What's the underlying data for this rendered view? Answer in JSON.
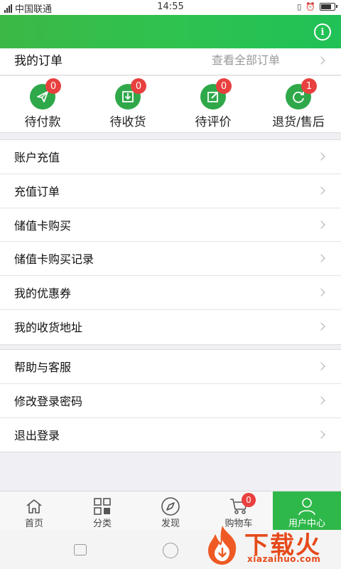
{
  "status_bar": {
    "carrier": "中国联通",
    "time": "14:55"
  },
  "orders": {
    "title": "我的订单",
    "view_all": "查看全部订单",
    "statuses": [
      {
        "label": "待付款",
        "badge": "0",
        "icon": "send-icon"
      },
      {
        "label": "待收货",
        "badge": "0",
        "icon": "download-box-icon"
      },
      {
        "label": "待评价",
        "badge": "0",
        "icon": "edit-icon"
      },
      {
        "label": "退货/售后",
        "badge": "1",
        "icon": "refresh-icon"
      }
    ]
  },
  "menu_group_1": [
    {
      "label": "账户充值"
    },
    {
      "label": "充值订单"
    },
    {
      "label": "储值卡购买"
    },
    {
      "label": "储值卡购买记录"
    },
    {
      "label": "我的优惠券"
    },
    {
      "label": "我的收货地址"
    }
  ],
  "menu_group_2": [
    {
      "label": "帮助与客服"
    },
    {
      "label": "修改登录密码"
    },
    {
      "label": "退出登录"
    }
  ],
  "tabbar": {
    "tabs": [
      {
        "label": "首页",
        "icon": "home-icon"
      },
      {
        "label": "分类",
        "icon": "grid-icon"
      },
      {
        "label": "发现",
        "icon": "compass-icon"
      },
      {
        "label": "购物车",
        "icon": "cart-icon",
        "badge": "0"
      },
      {
        "label": "用户中心",
        "icon": "user-icon",
        "active": true
      }
    ]
  },
  "watermark": {
    "title": "下载火",
    "domain": "xiazaihuo.com"
  },
  "colors": {
    "brand_green": "#2fb84a",
    "badge_red": "#e8403f",
    "watermark_orange": "#e64a1a"
  }
}
